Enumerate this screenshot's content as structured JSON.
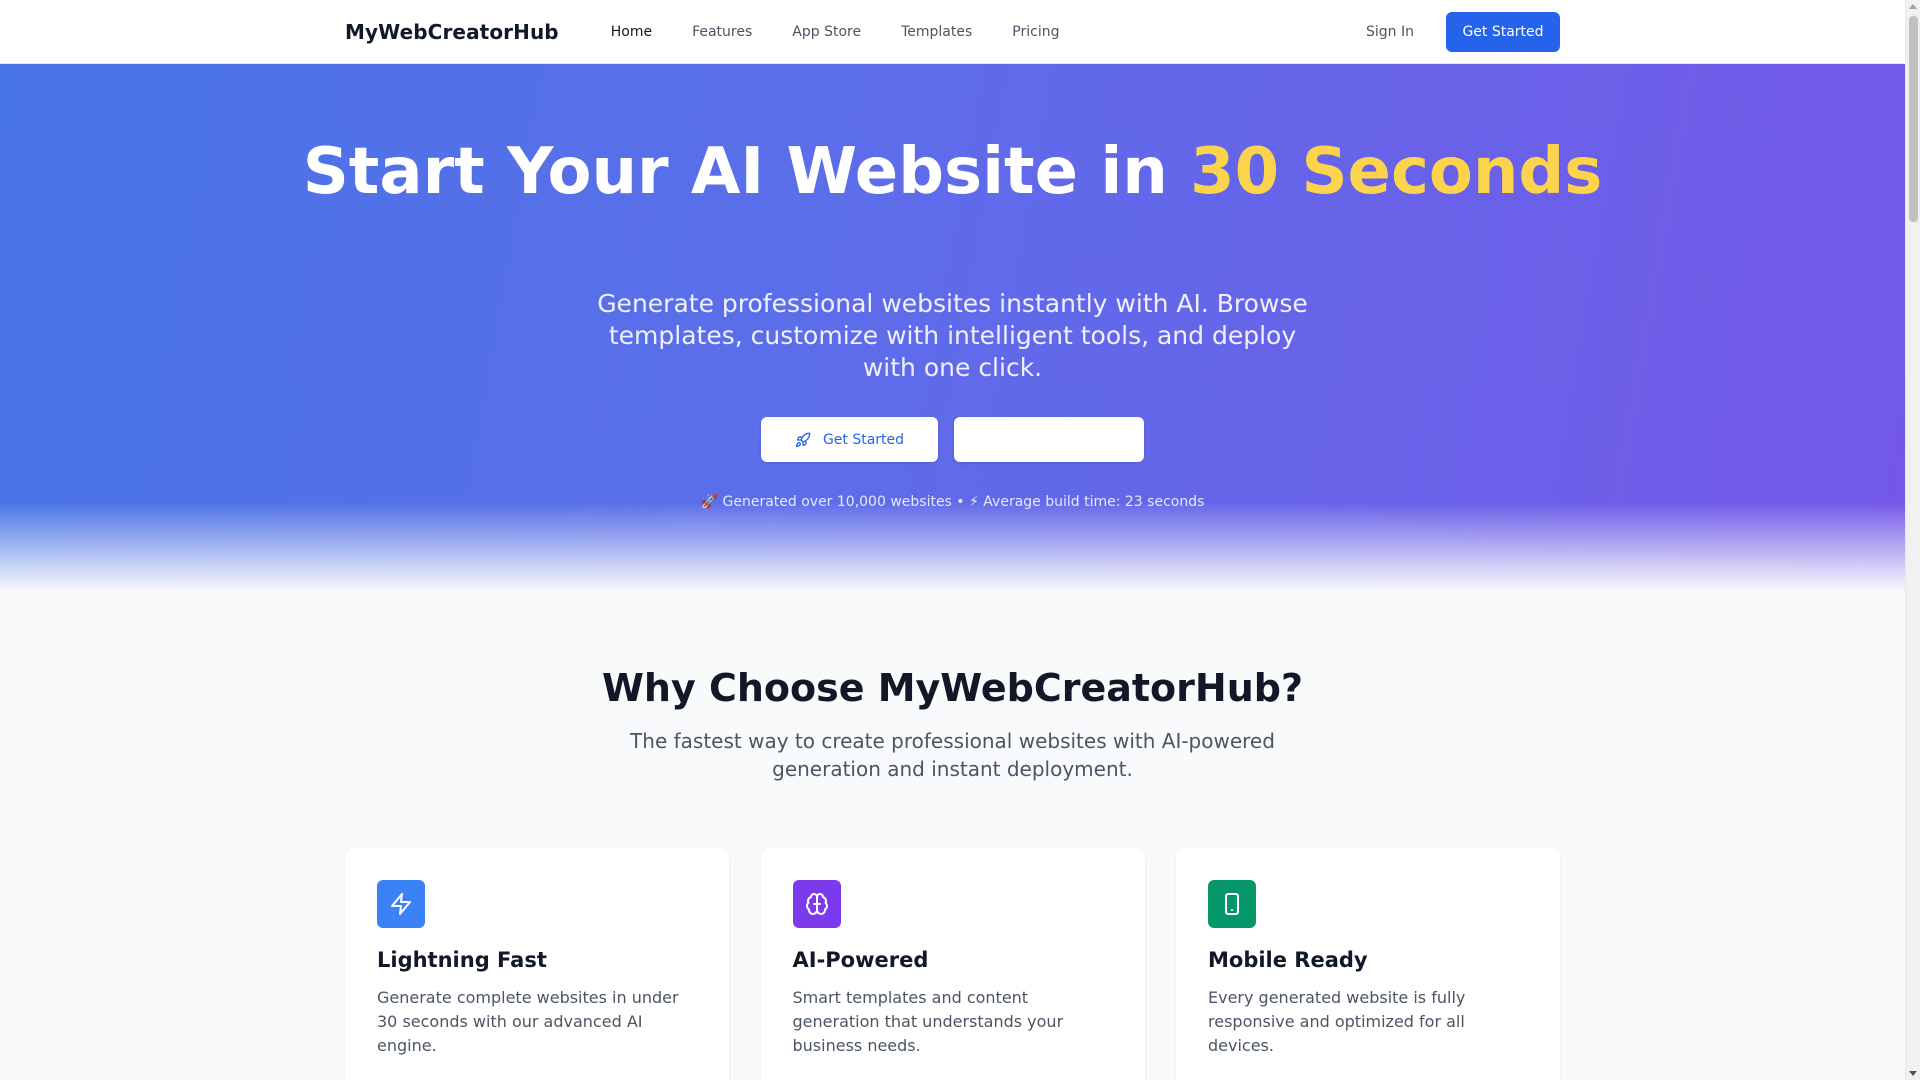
{
  "nav": {
    "brand": "MyWebCreatorHub",
    "links": [
      "Home",
      "Features",
      "App Store",
      "Templates",
      "Pricing"
    ],
    "active": "Home",
    "sign_in": "Sign In",
    "cta": "Get Started"
  },
  "hero": {
    "title_part1": "Start Your AI Website in ",
    "title_accent": "30 Seconds",
    "subtitle": "Generate professional websites instantly with AI. Browse templates, customize with intelligent tools, and deploy with one click.",
    "primary_button": "Get Started",
    "secondary_button": "",
    "stats": "🚀 Generated over 10,000 websites • ⚡ Average build time: 23 seconds"
  },
  "features": {
    "title": "Why Choose MyWebCreatorHub?",
    "subtitle": "The fastest way to create professional websites with AI-powered generation and instant deployment.",
    "cards": [
      {
        "title": "Lightning Fast",
        "text": "Generate complete websites in under 30 seconds with our advanced AI engine.",
        "icon": "lightning-icon",
        "color": "#3b82f6"
      },
      {
        "title": "AI-Powered",
        "text": "Smart templates and content generation that understands your business needs.",
        "icon": "brain-icon",
        "color": "#7c3aed"
      },
      {
        "title": "Mobile Ready",
        "text": "Every generated website is fully responsive and optimized for all devices.",
        "icon": "smartphone-icon",
        "color": "#059669"
      }
    ]
  },
  "colors": {
    "accent_blue": "#2563eb",
    "hero_accent_yellow": "#fcd34d"
  }
}
